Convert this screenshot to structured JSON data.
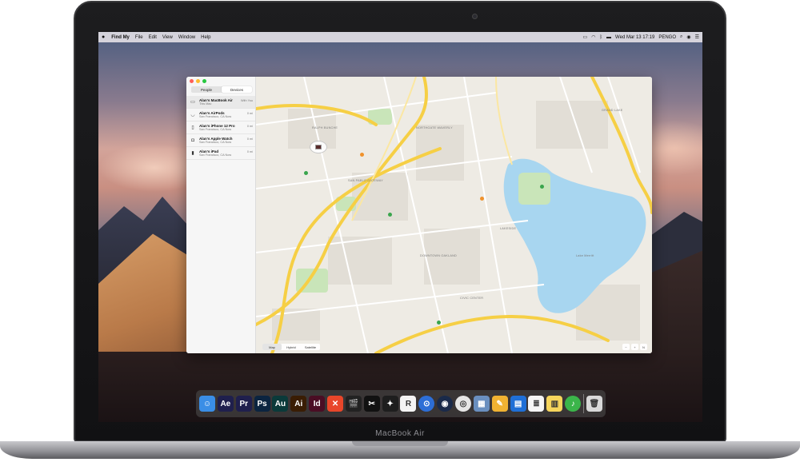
{
  "menubar": {
    "app_name": "Find My",
    "menus": [
      "File",
      "Edit",
      "View",
      "Window",
      "Help"
    ],
    "datetime": "Wed Mar 13  17:19",
    "user": "PENGO"
  },
  "sidebar": {
    "tabs": {
      "people": "People",
      "devices": "Devices"
    },
    "devices": [
      {
        "name": "Alan's MacBook Air",
        "location": "This Mac",
        "distance": "With You",
        "icon": "laptop-icon"
      },
      {
        "name": "Alan's AirPods",
        "location": "San Francisco, CA Now",
        "distance": "0 mi",
        "icon": "airpods-icon"
      },
      {
        "name": "Alan's iPhone 12 Pro",
        "location": "San Francisco, CA Now",
        "distance": "0 mi",
        "icon": "iphone-icon"
      },
      {
        "name": "Alan's Apple Watch",
        "location": "San Francisco, CA Now",
        "distance": "0 mi",
        "icon": "watch-icon"
      },
      {
        "name": "Alan's iPad",
        "location": "San Francisco, CA Now",
        "distance": "0 mi",
        "icon": "ipad-icon"
      }
    ]
  },
  "map": {
    "modes": {
      "map": "Map",
      "hybrid": "Hybrid",
      "satellite": "Satellite"
    },
    "labels": {
      "ralph_bunche": "RALPH BUNCHE",
      "san_pablo": "SAN PABLO GATEWAY",
      "downtown": "DOWNTOWN OAKLAND",
      "lakeside": "LAKESIDE",
      "grand_lake": "GRAND LAKE",
      "lake": "Lake Merritt",
      "civic": "CIVIC CENTER",
      "northgate": "NORTHGATE WAVERLY"
    }
  },
  "dock": {
    "apps": [
      {
        "name": "finder",
        "text": "☺",
        "color": "#3a8ee6"
      },
      {
        "name": "after-effects",
        "text": "Ae",
        "color": "#1f1f4d"
      },
      {
        "name": "premiere",
        "text": "Pr",
        "color": "#1f1f4d"
      },
      {
        "name": "photoshop",
        "text": "Ps",
        "color": "#0b2440"
      },
      {
        "name": "audition",
        "text": "Au",
        "color": "#0b3a3a"
      },
      {
        "name": "illustrator",
        "text": "Ai",
        "color": "#3a1d04"
      },
      {
        "name": "indesign",
        "text": "Id",
        "color": "#4a0d24"
      },
      {
        "name": "xmind",
        "text": "✕",
        "color": "#e8462a"
      },
      {
        "name": "final-cut",
        "text": "🎬",
        "color": "#222222"
      },
      {
        "name": "capcut",
        "text": "✂",
        "color": "#111111"
      },
      {
        "name": "figma",
        "text": "✦",
        "color": "#1e1e1e"
      },
      {
        "name": "r-app",
        "text": "R",
        "color": "#f4f4f4"
      },
      {
        "name": "proxyman",
        "text": "⊙",
        "color": "#2d6ed6"
      },
      {
        "name": "cinema4d",
        "text": "◉",
        "color": "#1a2a4a"
      },
      {
        "name": "chrome",
        "text": "◎",
        "color": "#e6e6e6"
      },
      {
        "name": "preview",
        "text": "▦",
        "color": "#6a8fbf"
      },
      {
        "name": "keynote",
        "text": "✎",
        "color": "#f0b232"
      },
      {
        "name": "presentation",
        "text": "▤",
        "color": "#1f6fd6"
      },
      {
        "name": "notes-list",
        "text": "≣",
        "color": "#f5f5f5"
      },
      {
        "name": "notes",
        "text": "▥",
        "color": "#f6d55c"
      },
      {
        "name": "itunes",
        "text": "♪",
        "color": "#3bb54a"
      },
      {
        "name": "trash",
        "text": "🗑",
        "color": "#d9d9d9"
      }
    ]
  },
  "device": {
    "brand": "MacBook Air"
  }
}
